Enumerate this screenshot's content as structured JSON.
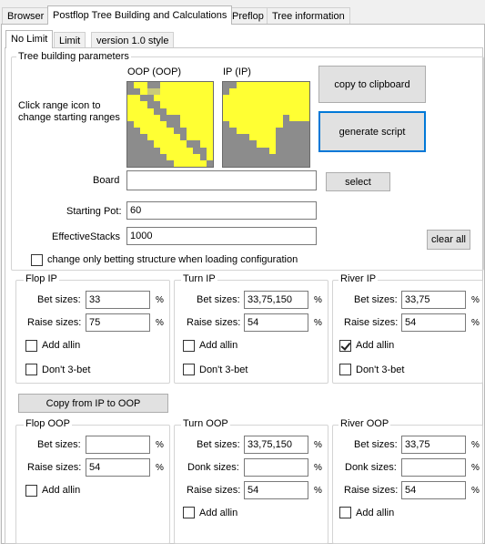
{
  "top_tabs": [
    "Browser",
    "Postflop Tree Building and Calculations",
    "Preflop",
    "Tree information"
  ],
  "sub_tabs": [
    "No Limit",
    "Limit",
    "version 1.0 style"
  ],
  "tree_params": {
    "legend": "Tree building parameters",
    "oop_label": "OOP (OOP)",
    "ip_label": "IP (IP)",
    "hint": "Click range icon to change starting ranges",
    "copy_clipboard": "copy to clipboard",
    "generate_script": "generate script",
    "board_label": "Board",
    "board_value": "",
    "select_button": "select",
    "starting_pot_label": "Starting Pot:",
    "starting_pot_value": "60",
    "effective_stacks_label": "EffectiveStacks",
    "effective_stacks_value": "1000",
    "clear_all_button": "clear all",
    "betting_structure_checkbox": "change only betting structure when loading configuration",
    "betting_structure_checked": false
  },
  "labels": {
    "bet_sizes": "Bet sizes:",
    "raise_sizes": "Raise sizes:",
    "donk_sizes": "Donk sizes:",
    "add_allin": "Add allin",
    "dont_3bet": "Don't 3-bet",
    "percent": "%"
  },
  "ip": {
    "flop": {
      "title": "Flop IP",
      "bet": "33",
      "raise": "75",
      "allin": false,
      "no3bet": false
    },
    "turn": {
      "title": "Turn IP",
      "bet": "33,75,150",
      "raise": "54",
      "allin": false,
      "no3bet": false
    },
    "river": {
      "title": "River IP",
      "bet": "33,75",
      "raise": "54",
      "allin": true,
      "no3bet": false
    }
  },
  "copy_ip_to_oop": "Copy from IP to OOP",
  "oop": {
    "flop": {
      "title": "Flop OOP",
      "bet": "",
      "raise": "54",
      "allin": false
    },
    "turn": {
      "title": "Turn OOP",
      "bet": "33,75,150",
      "donk": "",
      "raise": "54",
      "allin": false
    },
    "river": {
      "title": "River OOP",
      "bet": "33,75",
      "donk": "",
      "raise": "54",
      "allin": false
    }
  },
  "colors": {
    "range_selected": "#ffff33",
    "range_partial": "#c9c97a",
    "range_empty": "#8c8c8c",
    "focus_border": "#0078d7"
  },
  "range_oop": [
    "gyyggyyyyyyyy",
    "ggyppyyyyyyyy",
    "yyggyyyyyyyyy",
    "yyyggyyyyyyyy",
    "yyyyggyyyyyyy",
    "yyyyygggyyyyy",
    "gyyyyyggyyyyy",
    "ggyyyyyggyyyy",
    "gggyyyyygyyyy",
    "ggggyyyyyggyy",
    "gggggyyyyyggy",
    "ggggggyyyyygy",
    "gggggggyyyyyg"
  ],
  "range_ip": [
    "ggyyyyyyyyyyy",
    "gyyyyyyyyyyyy",
    "yyyyyyyyyyyyy",
    "yyyyyyyyyyyyy",
    "yyyyyyyyyyyyy",
    "yyyyyyyyygyyy",
    "gyyyyyyyygggg",
    "ggyyyyyyggggg",
    "ggggyyyyggggg",
    "gggggyyyggggg",
    "gggggggyggggg",
    "ggggggggggggg",
    "ggggggggggggg"
  ]
}
